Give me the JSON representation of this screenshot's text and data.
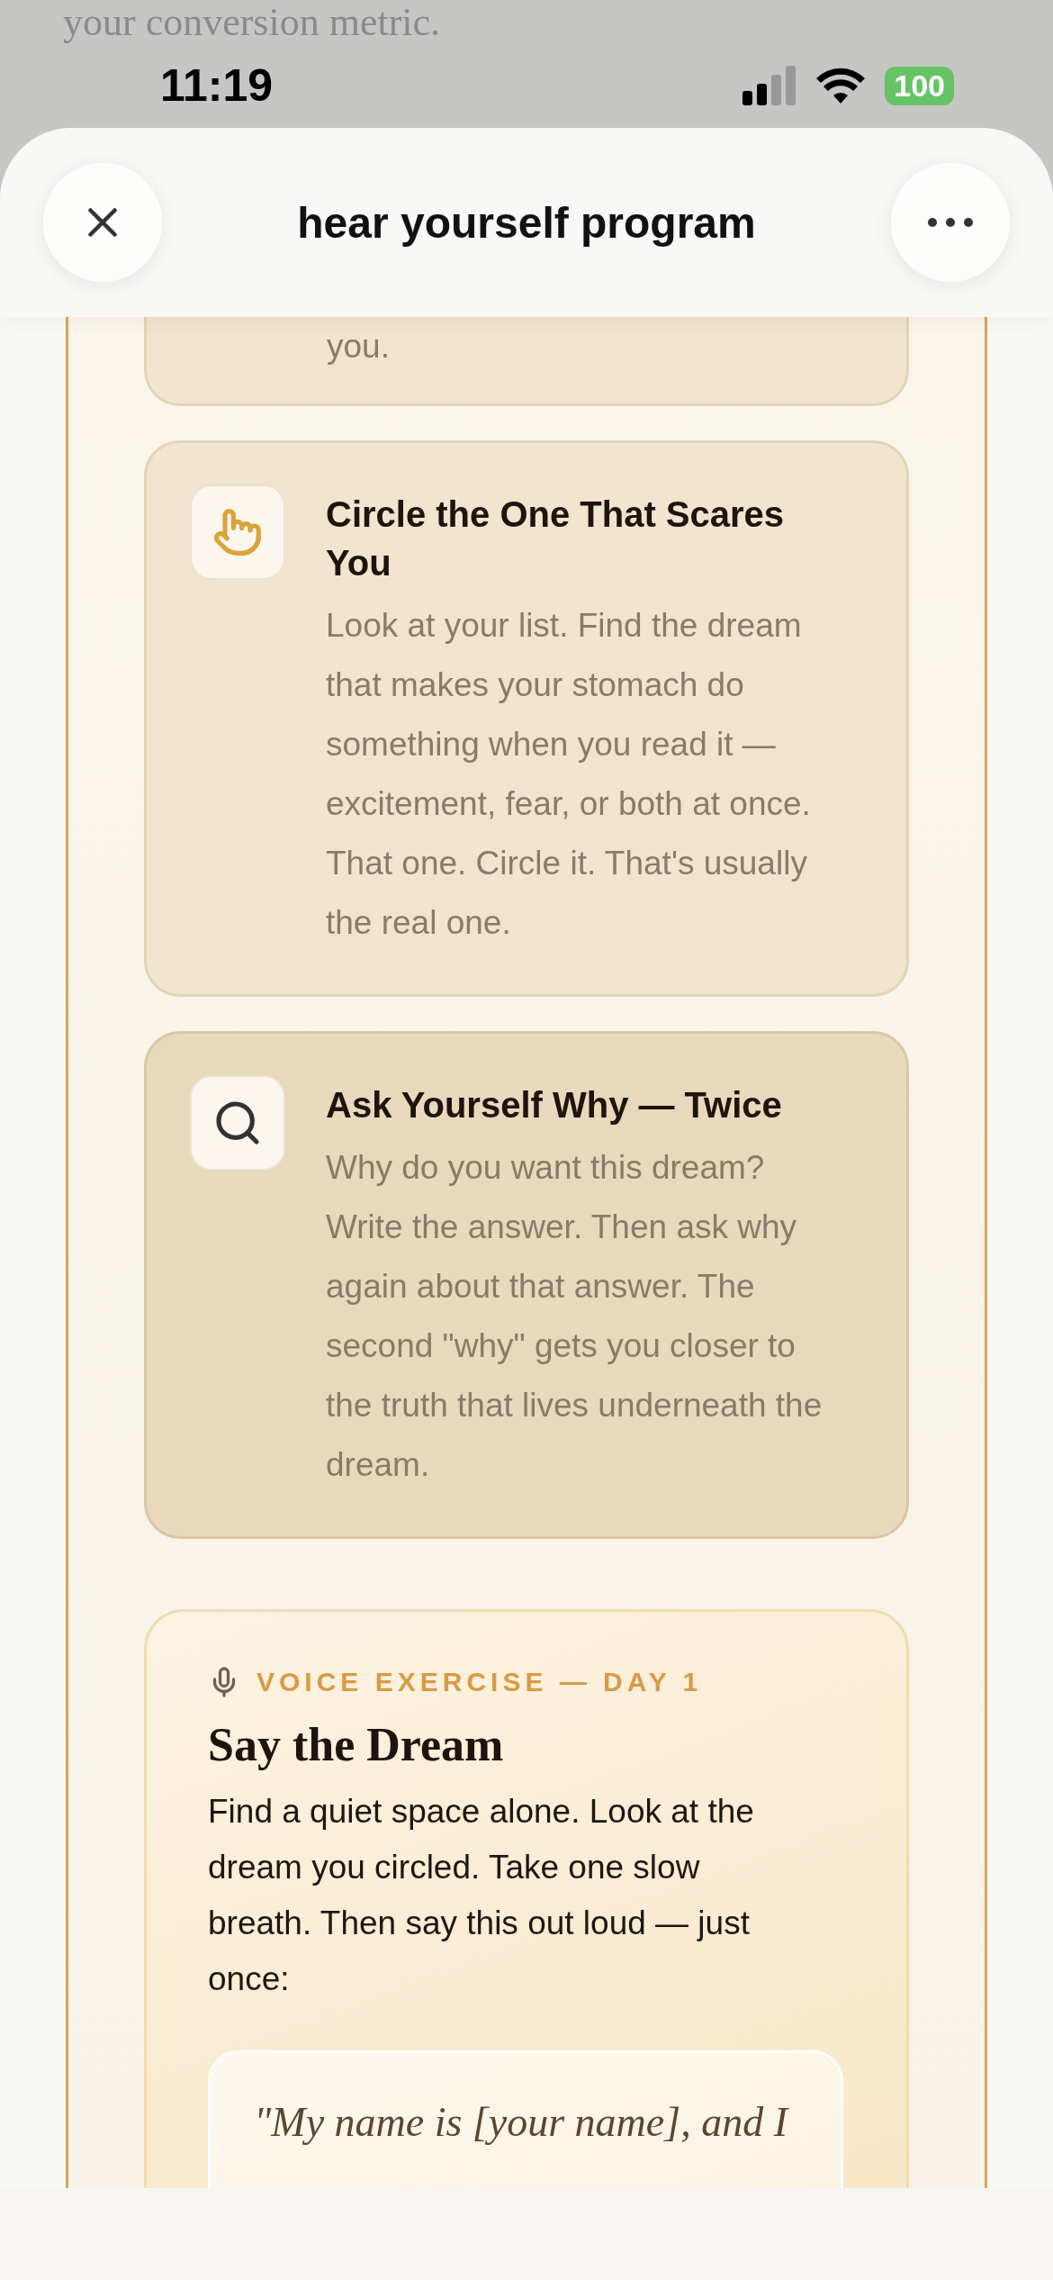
{
  "background_page": {
    "text": "your conversion metric."
  },
  "status_bar": {
    "time": "11:19",
    "battery": "100"
  },
  "header": {
    "title": "hear yourself program"
  },
  "steps": [
    {
      "kind": "clipped",
      "selected": false,
      "body": "you."
    },
    {
      "kind": "step",
      "selected": false,
      "title": "Circle the One That Scares You",
      "body": "Look at your list. Find the dream that makes your stomach do something when you read it — excitement, fear, or both at once. That one. Circle it. That's usually the real one."
    },
    {
      "kind": "step",
      "selected": true,
      "title": "Ask Yourself Why — Twice",
      "body": "Why do you want this dream? Write the answer. Then ask why again about that answer. The second \"why\" gets you closer to the truth that lives underneath the dream."
    }
  ],
  "exercise": {
    "label": "VOICE EXERCISE — DAY 1",
    "title": "Say the Dream",
    "body": "Find a quiet space alone. Look at the dream you circled. Take one slow breath. Then say this out loud — just once:",
    "quote": "\"My name is [your name], and I"
  }
}
